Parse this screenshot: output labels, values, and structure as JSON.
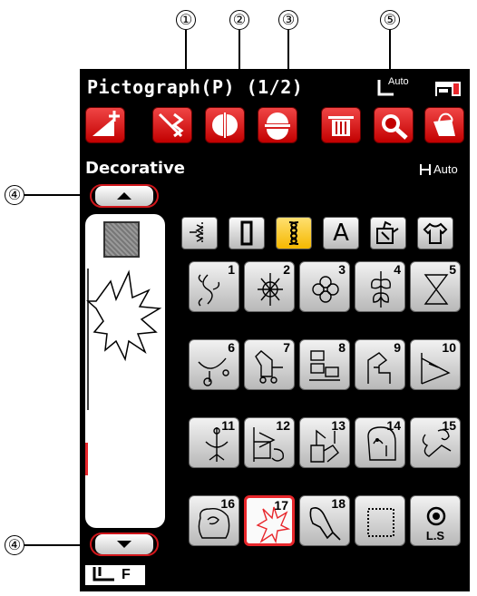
{
  "callouts": [
    "①",
    "②",
    "③",
    "⑤",
    "④",
    "④"
  ],
  "header": {
    "title": "Pictograph(P) (1/2)",
    "auto_label": "Auto"
  },
  "toolbar": [
    "elongation-icon",
    "mirror-vertical-icon",
    "mirror-horizontal-icon",
    "twin-needle-icon",
    "delete-icon",
    "zoom-icon",
    "bag-icon"
  ],
  "section": {
    "label": "Decorative",
    "auto_label": "Auto"
  },
  "category_tabs": [
    "buttonhole",
    "satin",
    "decorative",
    "letters",
    "quilt",
    "garment"
  ],
  "category_tab_letter": "A",
  "patterns": [
    {
      "num": "1"
    },
    {
      "num": "2"
    },
    {
      "num": "3"
    },
    {
      "num": "4"
    },
    {
      "num": "5"
    },
    {
      "num": "6"
    },
    {
      "num": "7"
    },
    {
      "num": "8"
    },
    {
      "num": "9"
    },
    {
      "num": "10"
    },
    {
      "num": "11"
    },
    {
      "num": "12"
    },
    {
      "num": "13"
    },
    {
      "num": "14"
    },
    {
      "num": "15"
    },
    {
      "num": "16"
    },
    {
      "num": "17"
    },
    {
      "num": "18"
    },
    {
      "num": ""
    },
    {
      "num": "",
      "label": "L.S"
    }
  ],
  "selected_pattern": "17",
  "presser_foot": "F",
  "colors": {
    "accent_red": "#e8262b",
    "selected_tab": "#f5b800",
    "screen_bg": "#000000"
  }
}
